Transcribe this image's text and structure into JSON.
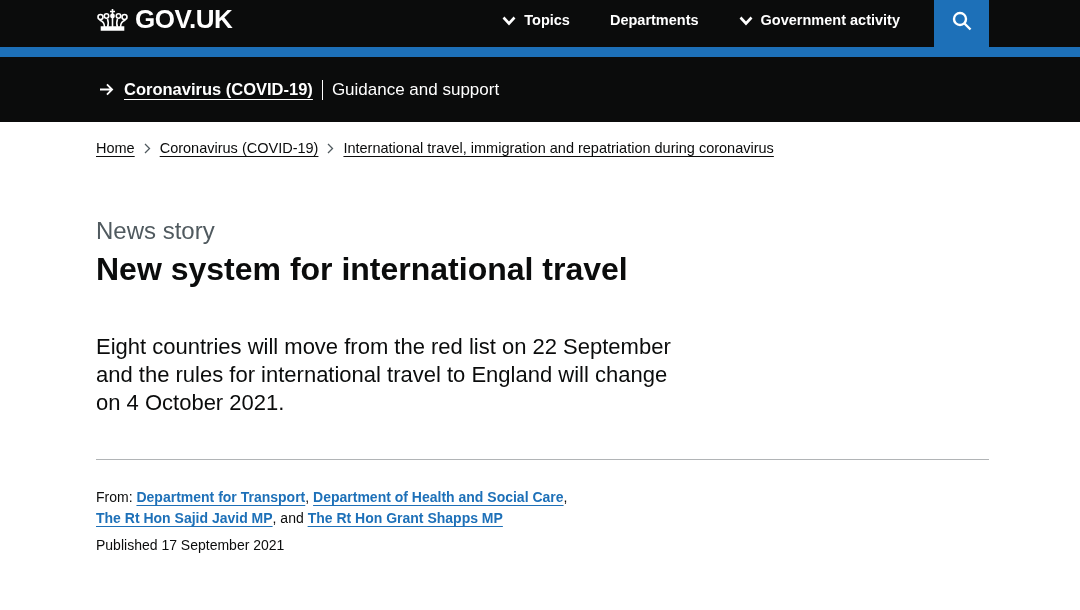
{
  "header": {
    "logo": "GOV.UK",
    "nav": [
      {
        "label": "Topics",
        "has_menu": true
      },
      {
        "label": "Departments",
        "has_menu": false
      },
      {
        "label": "Government activity",
        "has_menu": true
      }
    ]
  },
  "topic_bar": {
    "link": "Coronavirus (COVID-19)",
    "subtitle": "Guidance and support"
  },
  "breadcrumbs": [
    "Home",
    "Coronavirus (COVID-19)",
    "International travel, immigration and repatriation during coronavirus"
  ],
  "article": {
    "type_label": "News story",
    "title": "New system for international travel",
    "lead": "Eight countries will move from the red list on 22 September and the rules for international travel to England will change on 4 October 2021.",
    "from": [
      {
        "kind": "text",
        "text": "From: "
      },
      {
        "kind": "link",
        "text": "Department for Transport"
      },
      {
        "kind": "text",
        "text": ", "
      },
      {
        "kind": "link",
        "text": "Department of Health and Social Care"
      },
      {
        "kind": "text",
        "text": ", "
      },
      {
        "kind": "link",
        "text": "The Rt Hon Sajid Javid MP"
      },
      {
        "kind": "text",
        "text": ", and "
      },
      {
        "kind": "link",
        "text": "The Rt Hon Grant Shapps MP"
      }
    ],
    "published": "Published 17 September 2021"
  }
}
